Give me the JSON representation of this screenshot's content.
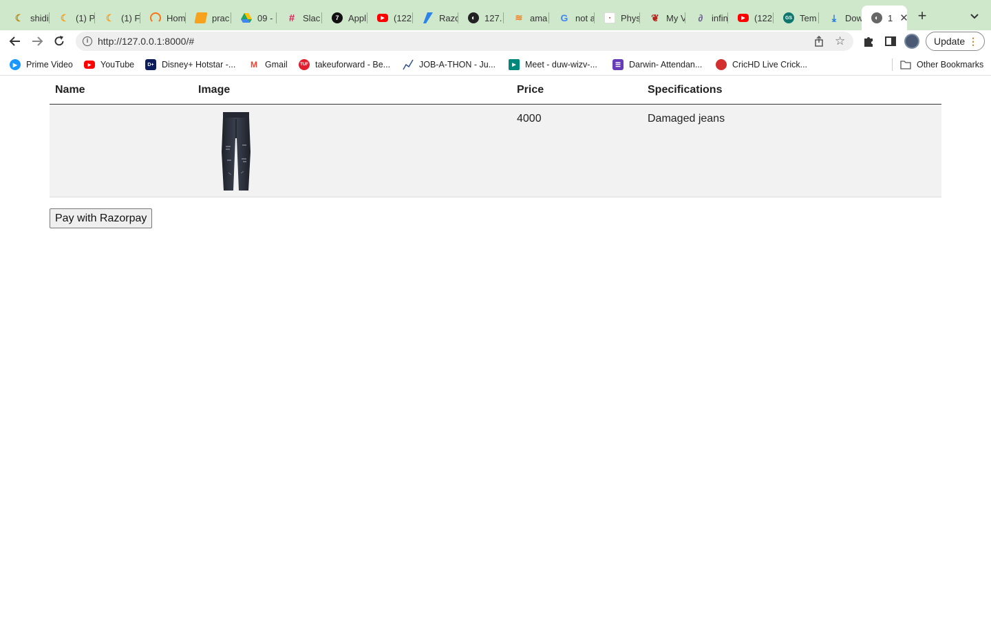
{
  "browser": {
    "tabs": [
      {
        "label": "shidi",
        "icon": "codeforces-icon",
        "color": "#b8860b"
      },
      {
        "label": "(1) P",
        "icon": "leetcode-icon",
        "color": "#f89f1b"
      },
      {
        "label": "(1) F",
        "icon": "leetcode-icon",
        "color": "#f89f1b"
      },
      {
        "label": "Hom",
        "icon": "coding-ninjas-icon",
        "color": "#f97316"
      },
      {
        "label": "prac",
        "icon": "notebook-icon",
        "color": "#f6a21e"
      },
      {
        "label": "09 -",
        "icon": "google-drive-icon",
        "color": "#1fa463"
      },
      {
        "label": "Slac",
        "icon": "slack-icon",
        "color": "#e01e5a"
      },
      {
        "label": "Appl",
        "icon": "app-icon",
        "color": "#111111"
      },
      {
        "label": "(122",
        "icon": "youtube-icon",
        "color": "#ff0000"
      },
      {
        "label": "Razo",
        "icon": "razorpay-icon",
        "color": "#2b84ea"
      },
      {
        "label": "127.",
        "icon": "globe-icon",
        "color": "#222222"
      },
      {
        "label": "ama",
        "icon": "stackoverflow-icon",
        "color": "#f48024"
      },
      {
        "label": "not a",
        "icon": "google-icon",
        "color": "#4285f4"
      },
      {
        "label": "Phys",
        "icon": "document-icon",
        "color": "#dddddd"
      },
      {
        "label": "My V",
        "icon": "feather-icon",
        "color": "#b3261e"
      },
      {
        "label": "infin",
        "icon": "link-icon",
        "color": "#6b5b95"
      },
      {
        "label": "(122",
        "icon": "youtube-icon",
        "color": "#ff0000"
      },
      {
        "label": "Tem",
        "icon": "emblem-icon",
        "color": "#0f766e"
      },
      {
        "label": "Dow",
        "icon": "download-icon",
        "color": "#1a73e8"
      },
      {
        "label": "1",
        "icon": "globe-icon",
        "color": "#555555"
      }
    ],
    "url": "http://127.0.0.1:8000/#",
    "update_label": "Update",
    "bookmarks": [
      {
        "label": "Prime Video",
        "icon": "prime-video-icon",
        "color": "#1a98ff"
      },
      {
        "label": "YouTube",
        "icon": "youtube-icon",
        "color": "#ff0000"
      },
      {
        "label": "Disney+ Hotstar -...",
        "icon": "hotstar-icon",
        "color": "#0c1c5c"
      },
      {
        "label": "Gmail",
        "icon": "gmail-icon",
        "color": "#ea4335"
      },
      {
        "label": "takeuforward - Be...",
        "icon": "takeuforward-icon",
        "color": "#e11d2e"
      },
      {
        "label": "JOB-A-THON - Ju...",
        "icon": "chart-line-icon",
        "color": "#2f4f8f"
      },
      {
        "label": "Meet - duw-wizv-...",
        "icon": "google-meet-icon",
        "color": "#00897b"
      },
      {
        "label": "Darwin- Attendan...",
        "icon": "form-icon",
        "color": "#673ab7"
      },
      {
        "label": "CricHD Live Crick...",
        "icon": "cricket-ball-icon",
        "color": "#d32f2f"
      }
    ],
    "other_bookmarks_label": "Other Bookmarks"
  },
  "page": {
    "table": {
      "headers": [
        "Name",
        "Image",
        "Price",
        "Specifications"
      ],
      "rows": [
        {
          "name": "",
          "image": "jeans-product-image",
          "price": "4000",
          "specifications": "Damaged jeans"
        }
      ]
    },
    "pay_button_label": "Pay with Razorpay"
  }
}
